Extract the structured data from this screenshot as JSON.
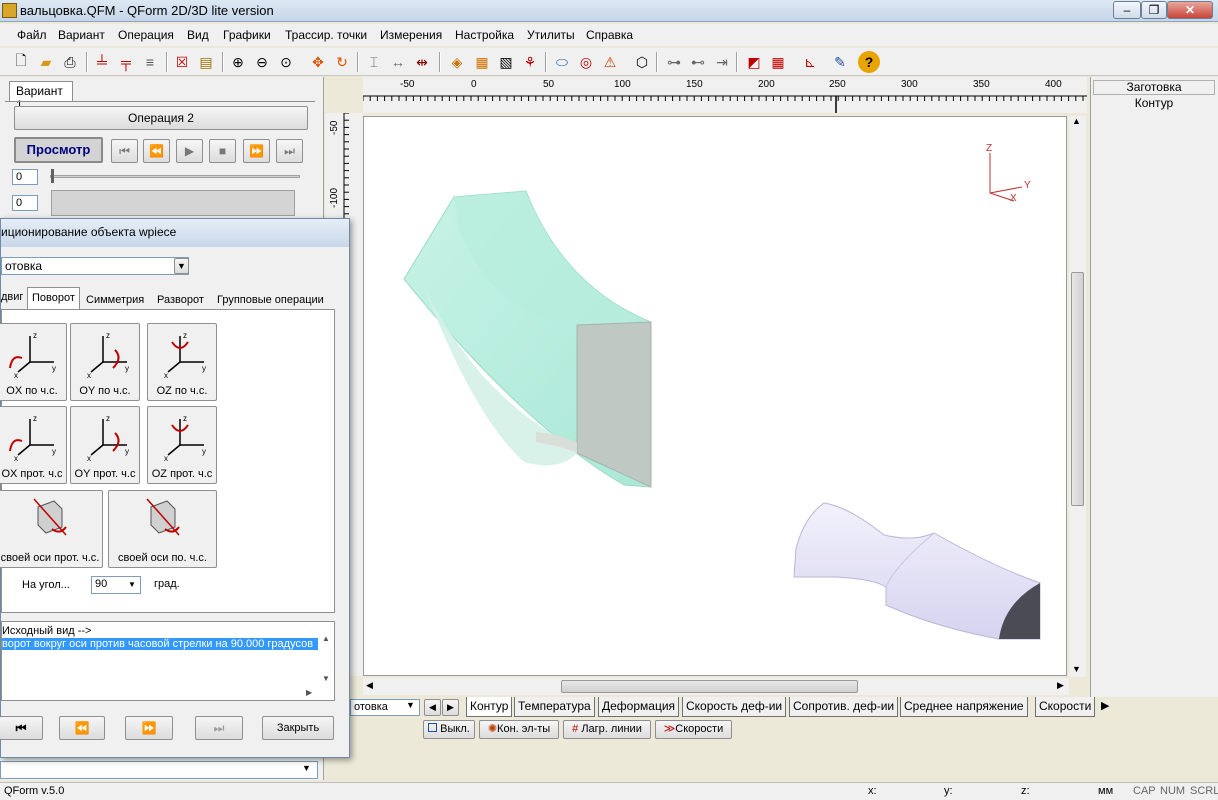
{
  "window": {
    "title": "вальцовка.QFM - QForm 2D/3D lite version",
    "btn_min": "–",
    "btn_max": "❐",
    "btn_close": "✕"
  },
  "menu": [
    "Файл",
    "Вариант",
    "Операция",
    "Вид",
    "Графики",
    "Трассир. точки",
    "Измерения",
    "Настройка",
    "Утилиты",
    "Справка"
  ],
  "toolbar_icons": [
    "new-icon",
    "open-icon",
    "print-icon",
    "add-tool-icon",
    "remove-tool-icon",
    "tool-align-icon",
    "delete-icon",
    "report-icon",
    "zoom-in-icon",
    "zoom-out-icon",
    "zoom-fit-icon",
    "move-icon",
    "rotate-icon",
    "measure-vertical-icon",
    "measure-horizontal-icon",
    "measure-distance-icon",
    "layers-icon",
    "grid-icon",
    "graph-icon",
    "trace-icon",
    "cylinder-icon",
    "ring-icon",
    "mesh-icon",
    "cube-icon",
    "roll-icon",
    "roll-forward-icon",
    "roll-end-icon",
    "color-scheme-icon",
    "color-grid-icon",
    "axes-icon",
    "paint-icon",
    "help-icon"
  ],
  "left_panel": {
    "variant_tab": "Вариант 1",
    "operation_button": "Операция 2",
    "view_button": "Просмотр",
    "frame_value": "0",
    "step_value": "0"
  },
  "dialog": {
    "title": "иционирование объекта wpiece",
    "object_select": "отовка",
    "tabs": [
      "двиг",
      "Поворот",
      "Симметрия",
      "Разворот",
      "Групповые операции"
    ],
    "active_tab": "Поворот",
    "rotate_buttons": [
      {
        "label": "OX по ч.с."
      },
      {
        "label": "OY по ч.с."
      },
      {
        "label": "OZ по ч.с."
      },
      {
        "label": "OX прот. ч.с"
      },
      {
        "label": "OY прот. ч.с"
      },
      {
        "label": "OZ прот. ч.с"
      }
    ],
    "own_axis_ccw": "своей оси прот. ч.с.",
    "own_axis_cw": "своей оси по. ч.с.",
    "angle_label": "На угол...",
    "angle_value": "90",
    "angle_unit": "град.",
    "history": [
      "Исходный вид -->",
      "ворот вокруг оси  против часовой стрелки на 90.000 градусов"
    ],
    "close_button": "Закрыть"
  },
  "ruler": {
    "h_ticks": [
      "-50",
      "0",
      "50",
      "100",
      "150",
      "200",
      "250",
      "300",
      "350",
      "400"
    ],
    "v_ticks": [
      "-50",
      "-100"
    ]
  },
  "axis_labels": {
    "z": "Z",
    "y": "Y",
    "x": "X"
  },
  "right_panel": {
    "header": "Заготовка",
    "item": "Контур"
  },
  "bottom": {
    "select_value": "отовка",
    "tabs": [
      "Контур",
      "Температура",
      "Деформация",
      "Скорость деф-ии",
      "Сопротив. деф-ии",
      "Среднее напряжение",
      "Скорости"
    ],
    "active_tab": "Контур",
    "toggles": [
      {
        "label": "Выкл."
      },
      {
        "label": "Кон. эл-ты"
      },
      {
        "label": "Лагр. линии"
      },
      {
        "label": "Скорости"
      }
    ]
  },
  "status": {
    "version": "QForm v.5.0",
    "x_label": "x:",
    "y_label": "y:",
    "z_label": "z:",
    "units": "мм",
    "cap": "CAP",
    "num": "NUM",
    "scrl": "SCRL"
  },
  "colors": {
    "titlebar": "#c9d9ea",
    "selection": "#3399ff",
    "workpiece_fill": "#bdf0e2",
    "roller_fill": "#dcdaf2",
    "view_button_text": "#000080"
  }
}
